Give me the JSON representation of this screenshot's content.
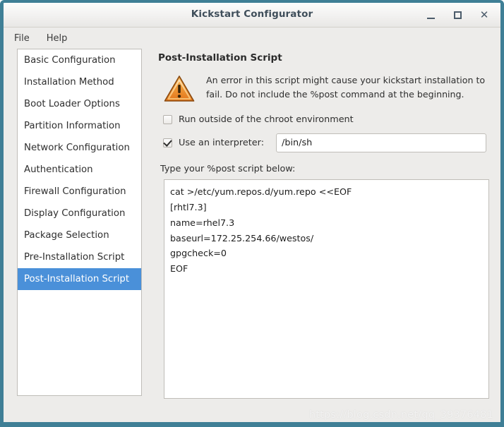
{
  "window": {
    "title": "Kickstart Configurator",
    "controls": {
      "minimize": "_",
      "maximize": "▢",
      "close": "✕"
    },
    "accent_border_color": "#3f7f96"
  },
  "menubar": {
    "items": [
      {
        "label": "File"
      },
      {
        "label": "Help"
      }
    ]
  },
  "sidebar": {
    "selected_index": 10,
    "selection_color": "#4a90d9",
    "items": [
      {
        "label": "Basic Configuration"
      },
      {
        "label": "Installation Method"
      },
      {
        "label": "Boot Loader Options"
      },
      {
        "label": "Partition Information"
      },
      {
        "label": "Network Configuration"
      },
      {
        "label": "Authentication"
      },
      {
        "label": "Firewall Configuration"
      },
      {
        "label": "Display Configuration"
      },
      {
        "label": "Package Selection"
      },
      {
        "label": "Pre-Installation Script"
      },
      {
        "label": "Post-Installation Script"
      }
    ]
  },
  "main": {
    "panel_title": "Post-Installation Script",
    "warning": {
      "icon": "warning-triangle-icon",
      "color": "#f0892a",
      "text": "An error in this script might cause your kickstart installation to fail. Do not include the %post command at the beginning."
    },
    "chroot_option": {
      "label": "Run outside of the chroot environment",
      "checked": false
    },
    "interpreter_option": {
      "label": "Use an interpreter:",
      "checked": true,
      "value": "/bin/sh",
      "placeholder": ""
    },
    "script": {
      "label": "Type your %post script below:",
      "content": "cat >/etc/yum.repos.d/yum.repo <<EOF\n[rhtl7.3]\nname=rhel7.3\nbaseurl=172.25.254.66/westos/\ngpgcheck=0\nEOF"
    }
  },
  "watermark": {
    "text": "https://blog.csdn.net/qq_39376481"
  }
}
